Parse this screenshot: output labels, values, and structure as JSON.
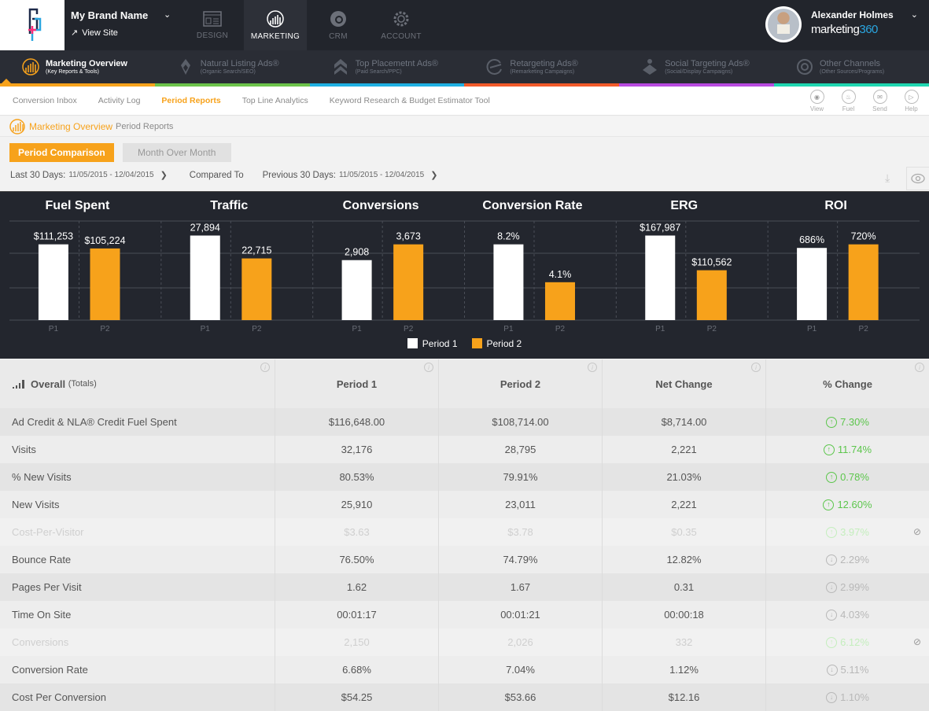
{
  "topbar": {
    "brand_name": "My Brand Name",
    "view_site": "View Site",
    "modules": [
      {
        "label": "DESIGN",
        "icon": "layout-icon",
        "active": false
      },
      {
        "label": "MARKETING",
        "icon": "chart-icon",
        "active": true
      },
      {
        "label": "CRM",
        "icon": "crm-icon",
        "active": false
      },
      {
        "label": "ACCOUNT",
        "icon": "gear-icon",
        "active": false
      }
    ],
    "user_name": "Alexander Holmes",
    "product_logo": "marketing",
    "product_logo_suffix": "360"
  },
  "channels": [
    {
      "title": "Marketing Overview",
      "subtitle": "(Key Reports & Tools)",
      "color": "#f7a21b",
      "active": true
    },
    {
      "title": "Natural Listing Ads®",
      "subtitle": "(Organic Search/SEO)",
      "color": "#6cc34a",
      "active": false
    },
    {
      "title": "Top Placemetnt Ads®",
      "subtitle": "(Paid Search/PPC)",
      "color": "#1fb0e3",
      "active": false
    },
    {
      "title": "Retargeting Ads®",
      "subtitle": "(Remarketing Campaigns)",
      "color": "#f25a2a",
      "active": false
    },
    {
      "title": "Social Targeting Ads®",
      "subtitle": "(Social/Display Campaigns)",
      "color": "#b84ae0",
      "active": false
    },
    {
      "title": "Other Channels",
      "subtitle": "(Other Sources/Programs)",
      "color": "#1fd6b0",
      "active": false
    }
  ],
  "subnav": {
    "items": [
      "Conversion Inbox",
      "Activity Log",
      "Period Reports",
      "Top Line Analytics",
      "Keyword Research & Budget Estimator Tool"
    ],
    "active": "Period Reports",
    "tools": [
      "View",
      "Fuel",
      "Send",
      "Help"
    ]
  },
  "breadcrumb": {
    "section": "Marketing Overview",
    "page": "Period Reports"
  },
  "period_tabs": {
    "active": "Period Comparison",
    "inactive": "Month Over Month"
  },
  "dates": {
    "range1_label": "Last 30 Days:",
    "range1_value": "11/05/2015 - 12/04/2015",
    "compared_to": "Compared To",
    "range2_label": "Previous 30 Days:",
    "range2_value": "11/05/2015 - 12/04/2015"
  },
  "chart_data": {
    "type": "bar",
    "groups": [
      {
        "title": "Fuel Spent",
        "p1": 111253,
        "p2": 105224,
        "p1_label": "$111,253",
        "p2_label": "$105,224"
      },
      {
        "title": "Traffic",
        "p1": 27894,
        "p2": 22715,
        "p1_label": "27,894",
        "p2_label": "22,715"
      },
      {
        "title": "Conversions",
        "p1": 2908,
        "p2": 3673,
        "p1_label": "2,908",
        "p2_label": "3,673"
      },
      {
        "title": "Conversion Rate",
        "p1": 8.2,
        "p2": 4.1,
        "p1_label": "8.2%",
        "p2_label": "4.1%"
      },
      {
        "title": "ERG",
        "p1": 167987,
        "p2": 110562,
        "p1_label": "$167,987",
        "p2_label": "$110,562"
      },
      {
        "title": "ROI",
        "p1": 686,
        "p2": 720,
        "p1_label": "686%",
        "p2_label": "720%"
      }
    ],
    "categories": [
      "P1",
      "P2"
    ],
    "legend": [
      {
        "name": "Period 1",
        "color": "#ffffff"
      },
      {
        "name": "Period 2",
        "color": "#f7a21b"
      }
    ],
    "grid": true,
    "legend_position": "bottom-center"
  },
  "table": {
    "headers": {
      "metric": "Overall",
      "metric_sub": "(Totals)",
      "p1": "Period 1",
      "p2": "Period 2",
      "net": "Net Change",
      "pct": "% Change"
    },
    "rows": [
      {
        "metric": "Ad Credit & NLA® Credit Fuel Spent",
        "p1": "$116,648.00",
        "p2": "$108,714.00",
        "net": "$8,714.00",
        "pct": "7.30%",
        "dir": "up",
        "disabled": false
      },
      {
        "metric": "Visits",
        "p1": "32,176",
        "p2": "28,795",
        "net": "2,221",
        "pct": "11.74%",
        "dir": "up",
        "disabled": false
      },
      {
        "metric": "% New Visits",
        "p1": "80.53%",
        "p2": "79.91%",
        "net": "21.03%",
        "pct": "0.78%",
        "dir": "up",
        "disabled": false
      },
      {
        "metric": "New Visits",
        "p1": "25,910",
        "p2": "23,011",
        "net": "2,221",
        "pct": "12.60%",
        "dir": "up",
        "disabled": false
      },
      {
        "metric": "Cost-Per-Visitor",
        "p1": "$3.63",
        "p2": "$3.78",
        "net": "$0.35",
        "pct": "3.97%",
        "dir": "up",
        "disabled": true
      },
      {
        "metric": "Bounce Rate",
        "p1": "76.50%",
        "p2": "74.79%",
        "net": "12.82%",
        "pct": "2.29%",
        "dir": "down",
        "disabled": false
      },
      {
        "metric": "Pages Per Visit",
        "p1": "1.62",
        "p2": "1.67",
        "net": "0.31",
        "pct": "2.99%",
        "dir": "down",
        "disabled": false
      },
      {
        "metric": "Time On Site",
        "p1": "00:01:17",
        "p2": "00:01:21",
        "net": "00:00:18",
        "pct": "4.03%",
        "dir": "down",
        "disabled": false
      },
      {
        "metric": "Conversions",
        "p1": "2,150",
        "p2": "2,026",
        "net": "332",
        "pct": "6.12%",
        "dir": "up",
        "disabled": true
      },
      {
        "metric": "Conversion Rate",
        "p1": "6.68%",
        "p2": "7.04%",
        "net": "1.12%",
        "pct": "5.11%",
        "dir": "down",
        "disabled": false
      },
      {
        "metric": "Cost Per Conversion",
        "p1": "$54.25",
        "p2": "$53.66",
        "net": "$12.16",
        "pct": "1.10%",
        "dir": "down",
        "disabled": false
      }
    ]
  }
}
